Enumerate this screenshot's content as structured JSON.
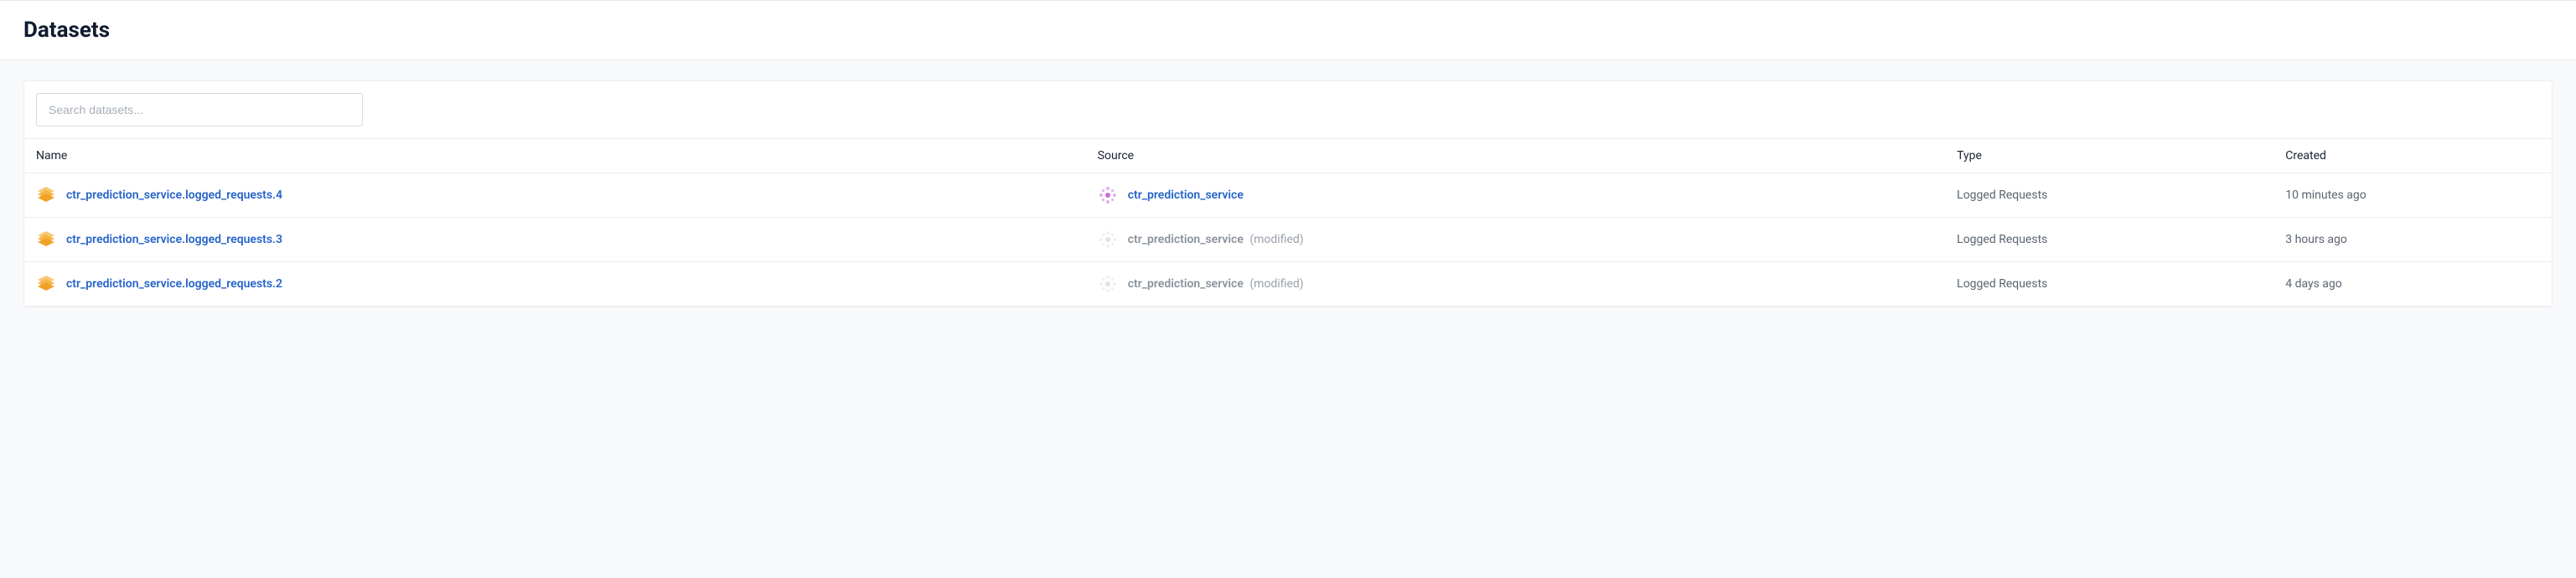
{
  "header": {
    "title": "Datasets"
  },
  "search": {
    "placeholder": "Search datasets..."
  },
  "table": {
    "headers": {
      "name": "Name",
      "source": "Source",
      "type": "Type",
      "created": "Created"
    },
    "rows": [
      {
        "name": "ctr_prediction_service.logged_requests.4",
        "source": "ctr_prediction_service",
        "source_suffix": "",
        "source_active": true,
        "type": "Logged Requests",
        "created": "10 minutes ago"
      },
      {
        "name": "ctr_prediction_service.logged_requests.3",
        "source": "ctr_prediction_service",
        "source_suffix": "(modified)",
        "source_active": false,
        "type": "Logged Requests",
        "created": "3 hours ago"
      },
      {
        "name": "ctr_prediction_service.logged_requests.2",
        "source": "ctr_prediction_service",
        "source_suffix": "(modified)",
        "source_active": false,
        "type": "Logged Requests",
        "created": "4 days ago"
      }
    ]
  }
}
